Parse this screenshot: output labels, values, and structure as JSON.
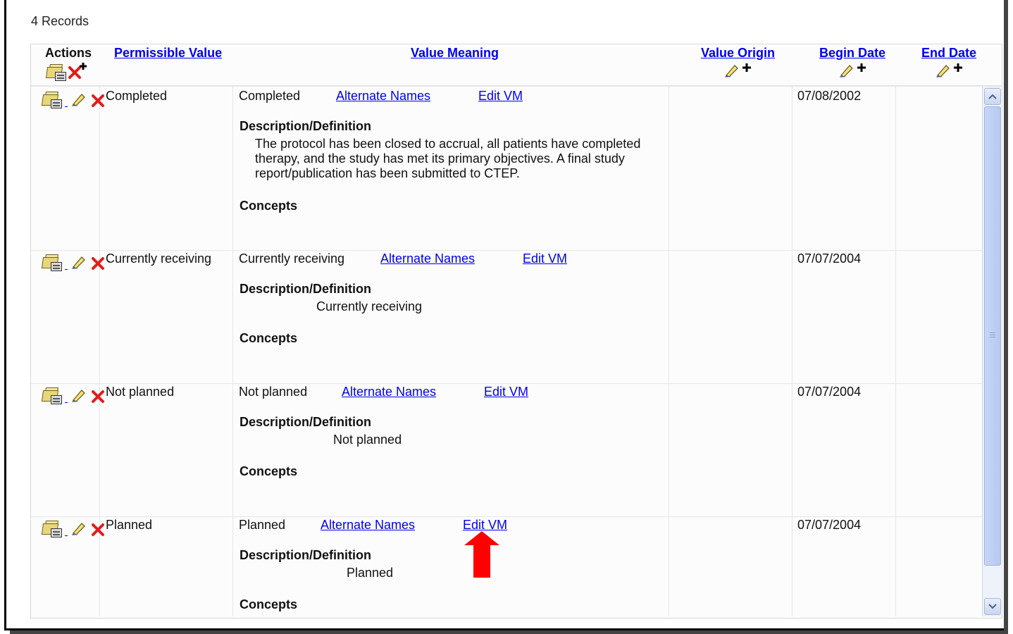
{
  "records_label": "4 Records",
  "headers": {
    "actions": "Actions",
    "permissible_value": "Permissible Value",
    "value_meaning": "Value Meaning",
    "value_origin": "Value Origin",
    "begin_date": "Begin Date",
    "end_date": "End Date"
  },
  "labels": {
    "alternate_names": "Alternate Names",
    "edit_vm": "Edit VM",
    "description": "Description/Definition",
    "concepts": "Concepts"
  },
  "rows": [
    {
      "permissible_value": "Completed",
      "value_meaning": "Completed",
      "description": [
        "The protocol has been closed to accrual, all patients have completed",
        "therapy, and the study has met its primary objectives. A final study",
        "report/publication has been submitted to CTEP."
      ],
      "begin_date": "07/08/2002",
      "end_date": "",
      "value_origin": ""
    },
    {
      "permissible_value": "Currently receiving",
      "value_meaning": "Currently receiving",
      "description": [
        "Currently receiving"
      ],
      "begin_date": "07/07/2004",
      "end_date": "",
      "value_origin": ""
    },
    {
      "permissible_value": "Not planned",
      "value_meaning": "Not planned",
      "description": [
        "Not planned"
      ],
      "begin_date": "07/07/2004",
      "end_date": "",
      "value_origin": ""
    },
    {
      "permissible_value": "Planned",
      "value_meaning": "Planned",
      "description": [
        "Planned"
      ],
      "begin_date": "07/07/2004",
      "end_date": "",
      "value_origin": ""
    }
  ],
  "colors": {
    "link": "#0000ee",
    "delete_red": "#e31b1b",
    "annotation_arrow": "#ff0000",
    "scrollbar": "#c7d6f6"
  },
  "icons": [
    "folder-view-icon",
    "edit-pencil-icon",
    "delete-x-icon",
    "add-plus-icon",
    "scroll-up-icon",
    "scroll-down-icon",
    "red-arrow-annotation"
  ]
}
